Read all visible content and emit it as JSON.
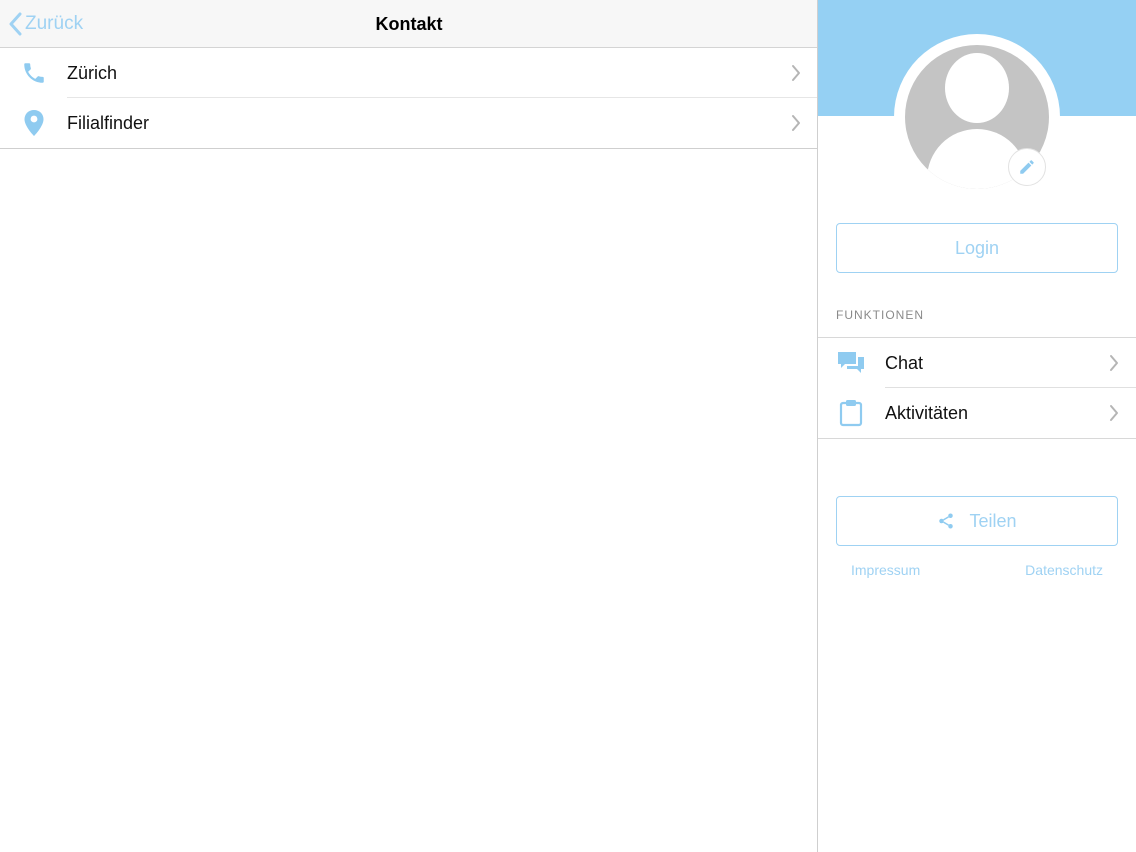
{
  "navbar": {
    "back_label": "Zurück",
    "title": "Kontakt"
  },
  "contact_list": [
    {
      "label": "Zürich",
      "icon": "phone-icon"
    },
    {
      "label": "Filialfinder",
      "icon": "location-pin-icon"
    }
  ],
  "sidebar": {
    "login_label": "Login",
    "section_header": "FUNKTIONEN",
    "functions": [
      {
        "label": "Chat",
        "icon": "chat-icon"
      },
      {
        "label": "Aktivitäten",
        "icon": "clipboard-icon"
      }
    ],
    "share_label": "Teilen",
    "impressum_label": "Impressum",
    "datenschutz_label": "Datenschutz"
  },
  "colors": {
    "accent": "#9fd2f3",
    "banner": "#95d0f3",
    "avatar_gray": "#c4c4c4"
  }
}
